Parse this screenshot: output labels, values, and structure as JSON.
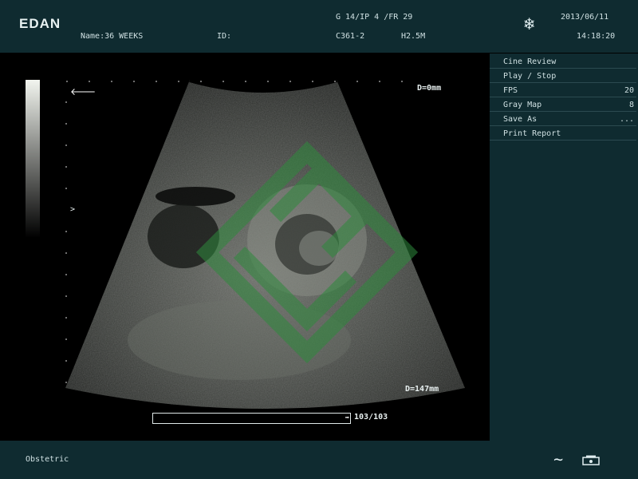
{
  "header": {
    "brand": "EDAN",
    "patient_name": "Name:36 WEEKS",
    "id_label": "ID:",
    "gain_line": "G 14/IP 4 /FR 29",
    "probe": "C361-2",
    "harmonic": "H2.5M",
    "date": "2013/06/11",
    "time": "14:18:20",
    "freeze_icon": "snowflake-icon"
  },
  "image": {
    "depth_top": "D=0mm",
    "depth_bottom": "D=147mm",
    "focus_marker": ">",
    "frame_counter": "103/103",
    "cine_progress": 1.0,
    "direction_marker_icon": "left-arrow-icon"
  },
  "menu": {
    "items": [
      {
        "label": "Cine Review",
        "value": ""
      },
      {
        "label": "Play / Stop",
        "value": ""
      },
      {
        "label": "FPS",
        "value": "20"
      },
      {
        "label": "Gray Map",
        "value": "8"
      },
      {
        "label": "Save As",
        "value": "..."
      },
      {
        "label": "Print Report",
        "value": ""
      }
    ]
  },
  "footer": {
    "mode": "Obstetric",
    "wave_icon": "trackball-icon",
    "printer_icon": "printer-icon"
  },
  "colors": {
    "panel_bg": "#0f2b30",
    "watermark": "#2e7a3c"
  }
}
